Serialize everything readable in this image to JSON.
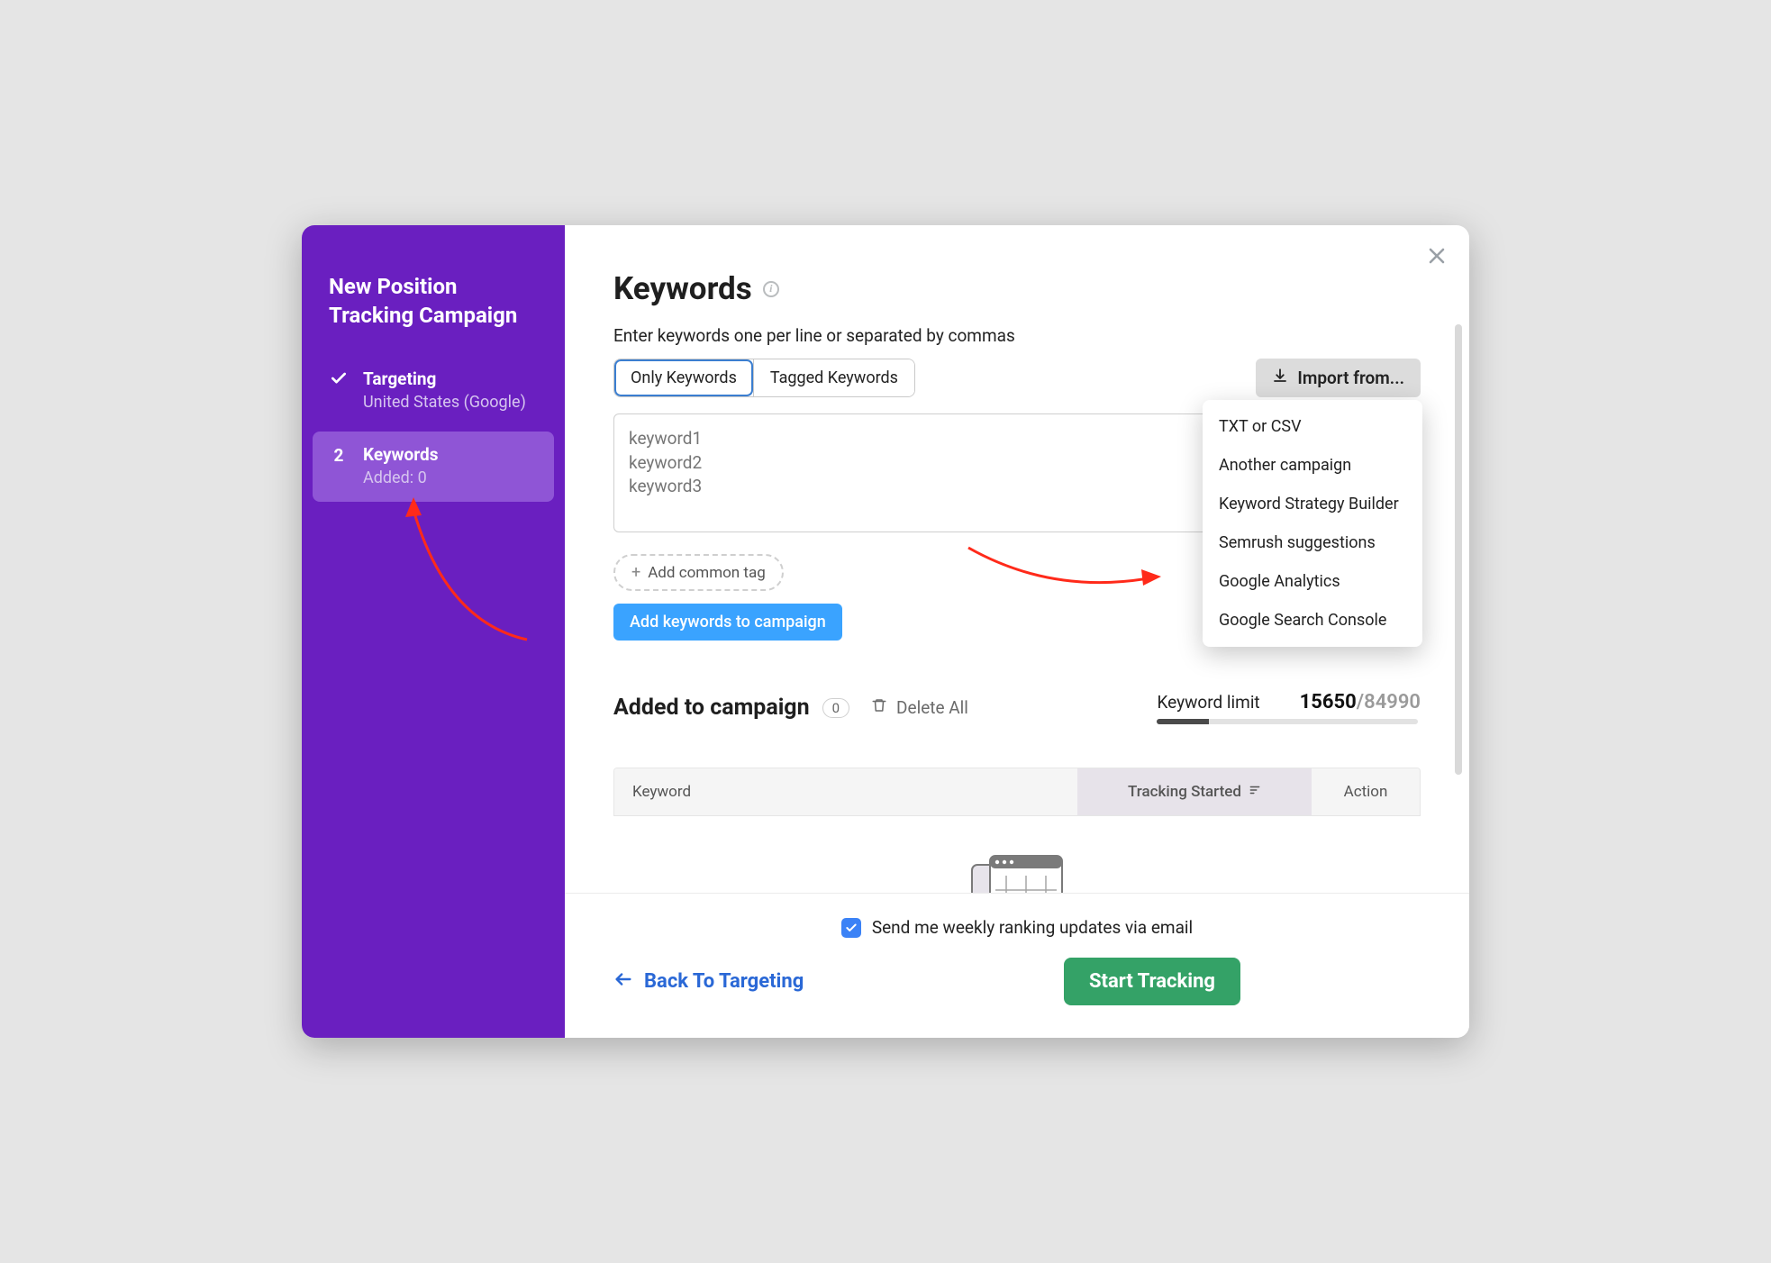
{
  "sidebar": {
    "title": "New Position Tracking Campaign",
    "steps": [
      {
        "marker": "check",
        "label": "Targeting",
        "sub": "United States (Google)"
      },
      {
        "marker": "2",
        "label": "Keywords",
        "sub": "Added: 0"
      }
    ]
  },
  "page": {
    "title": "Keywords",
    "helper": "Enter keywords one per line or separated by commas"
  },
  "tabs": {
    "only": "Only Keywords",
    "tagged": "Tagged Keywords"
  },
  "import": {
    "label": "Import from...",
    "options": [
      "TXT or CSV",
      "Another campaign",
      "Keyword Strategy Builder",
      "Semrush suggestions",
      "Google Analytics",
      "Google Search Console"
    ]
  },
  "textarea": {
    "placeholder": "keyword1\nkeyword2\nkeyword3"
  },
  "buttons": {
    "add_tag": "Add common tag",
    "add_keywords": "Add keywords to campaign",
    "delete_all": "Delete All",
    "back": "Back To Targeting",
    "start": "Start Tracking"
  },
  "added": {
    "title": "Added to campaign",
    "count": "0"
  },
  "limit": {
    "label": "Keyword limit",
    "used": "15650",
    "max": "84990"
  },
  "table": {
    "col_keyword": "Keyword",
    "col_tracking": "Tracking Started",
    "col_action": "Action"
  },
  "footer": {
    "email_label": "Send me weekly ranking updates via email"
  }
}
